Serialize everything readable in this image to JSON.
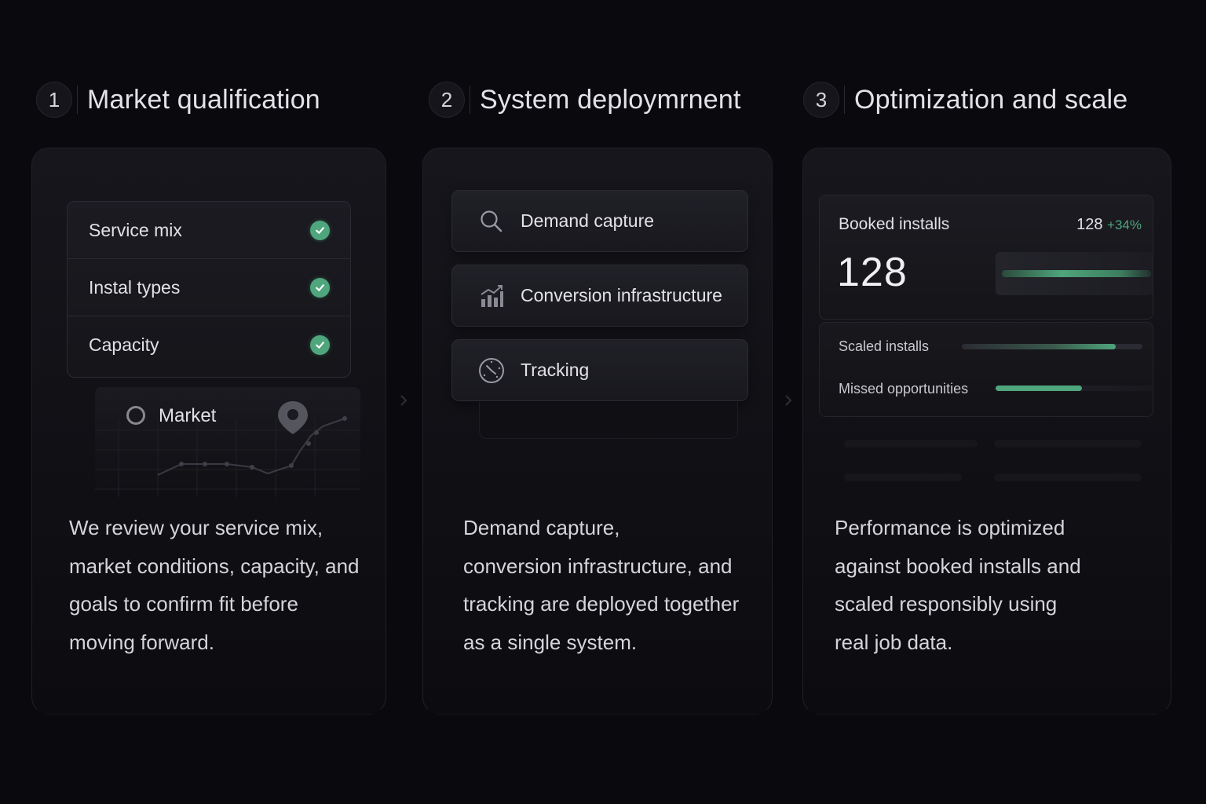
{
  "steps": [
    {
      "number": "1",
      "title": "Market qualification",
      "checklist": [
        {
          "label": "Service mix",
          "checked": true
        },
        {
          "label": "Instal types",
          "checked": true
        },
        {
          "label": "Capacity",
          "checked": true
        }
      ],
      "market_label": "Market",
      "description": [
        "We review your service mix,",
        "market conditions, capacity, and",
        "goals to confirm fit before",
        "moving forward."
      ]
    },
    {
      "number": "2",
      "title": "System deploymrnent",
      "items": [
        {
          "label": "Demand capture",
          "icon": "search-icon"
        },
        {
          "label": "Conversion infrastructure",
          "icon": "bar-chart-icon"
        },
        {
          "label": "Tracking",
          "icon": "clock-icon"
        }
      ],
      "description": [
        "Demand capture,",
        "conversion infrastructure, and",
        "tracking are deployed together",
        "as a single system."
      ]
    },
    {
      "number": "3",
      "title": "Optimization and scale",
      "metric": {
        "title": "Booked installs",
        "value_small": "128",
        "delta": "+34%",
        "value_big": "128",
        "spark_level": 0.95
      },
      "bars": [
        {
          "label": "Scaled installs",
          "level": 0.85
        },
        {
          "label": "Missed opportunities",
          "level": 0.55
        }
      ],
      "description": [
        "Performance is optimized",
        "against booked installs and",
        "scaled responsibly using",
        "real job data."
      ]
    }
  ],
  "colors": {
    "background": "#0a0a0e",
    "accent_green": "#4fa57c"
  }
}
